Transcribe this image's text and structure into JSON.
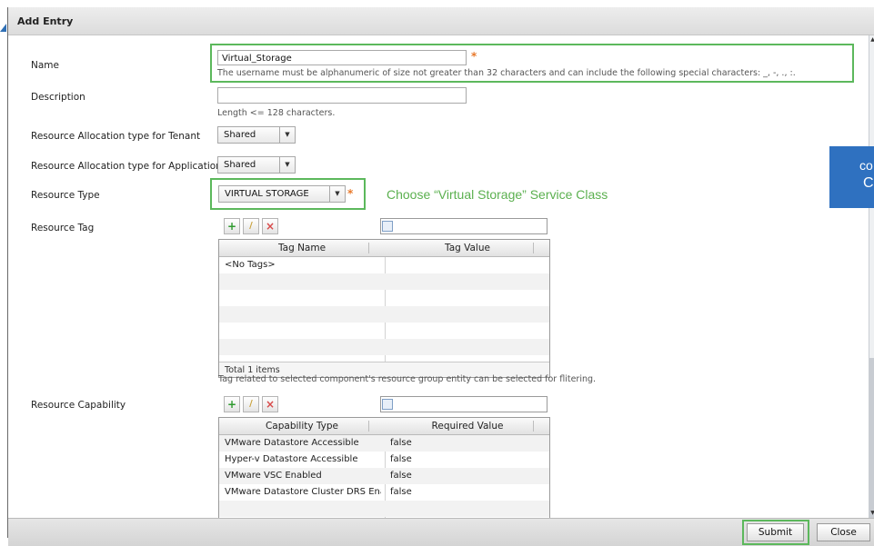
{
  "dialog": {
    "title": "Add Entry"
  },
  "form": {
    "name": {
      "label": "Name",
      "value": "Virtual_Storage",
      "hint": "The username must be alphanumeric of size not greater than 32 characters and can include the following special characters: _, -, ., :."
    },
    "description": {
      "label": "Description",
      "value": "",
      "hint": "Length <= 128 characters."
    },
    "tenant_alloc": {
      "label": "Resource Allocation type for Tenant",
      "value": "Shared"
    },
    "app_alloc": {
      "label": "Resource Allocation type for Application",
      "value": "Shared"
    },
    "resource_type": {
      "label": "Resource Type",
      "value": "VIRTUAL STORAGE"
    },
    "resource_tag": {
      "label": "Resource Tag",
      "columns": [
        "Tag Name",
        "Tag Value"
      ],
      "rows": [
        [
          "<No Tags>",
          ""
        ]
      ],
      "footer": "Total 1 items",
      "hint": "Tag related to selected component's resource group entity can be selected for flitering."
    },
    "resource_capability": {
      "label": "Resource Capability",
      "columns": [
        "Capability Type",
        "Required Value"
      ],
      "rows": [
        [
          "VMware Datastore Accessible",
          "false"
        ],
        [
          "Hyper-v Datastore Accessible",
          "false"
        ],
        [
          "VMware VSC Enabled",
          "false"
        ],
        [
          "VMware Datastore Cluster DRS Ena",
          "false"
        ]
      ]
    },
    "required_mark": "*"
  },
  "annotation": {
    "text": "Choose “Virtual Storage” Service Class"
  },
  "callout": {
    "line1": "co",
    "line2": "C"
  },
  "footer": {
    "submit_label": "Submit",
    "close_label": "Close"
  },
  "toolbar": {
    "add_glyph": "+",
    "edit_glyph": "/",
    "delete_glyph": "×"
  },
  "colors": {
    "highlight_green": "#5cb85c",
    "annotation_green": "#5bb04f",
    "callout_blue": "#2f71c0",
    "required_orange": "#e8782a"
  }
}
